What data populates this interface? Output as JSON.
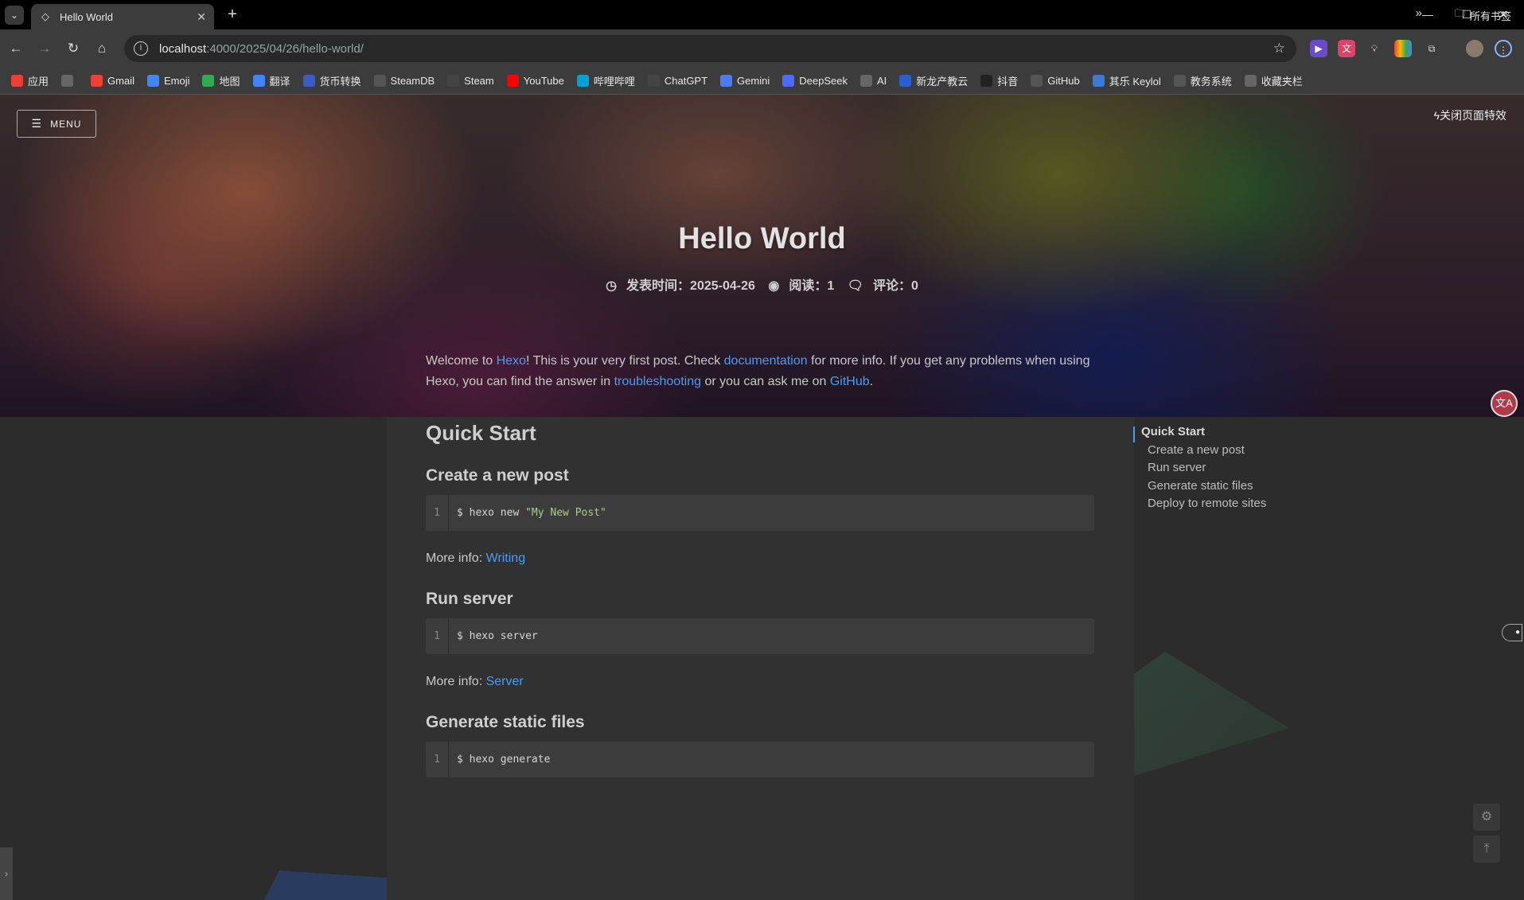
{
  "browser": {
    "tab_title": "Hello World",
    "url_host": "localhost",
    "url_path": ":4000/2025/04/26/hello-world/",
    "bookmarks": [
      {
        "label": "应用",
        "icon": "apps-grid-icon",
        "color": "#e94235"
      },
      {
        "label": "",
        "icon": "grid-icon",
        "color": "#666666"
      },
      {
        "label": "Gmail",
        "icon": "gmail-icon",
        "color": "#ea4335"
      },
      {
        "label": "Emoji",
        "icon": "google-icon",
        "color": "#4285f4"
      },
      {
        "label": "地图",
        "icon": "maps-icon",
        "color": "#34a853"
      },
      {
        "label": "翻译",
        "icon": "translate-icon",
        "color": "#4285f4"
      },
      {
        "label": "货币转换",
        "icon": "currency-icon",
        "color": "#3b5cc4"
      },
      {
        "label": "SteamDB",
        "icon": "steamdb-icon",
        "color": "#555555"
      },
      {
        "label": "Steam",
        "icon": "steam-icon",
        "color": "#444444"
      },
      {
        "label": "YouTube",
        "icon": "youtube-icon",
        "color": "#ff0000"
      },
      {
        "label": "哔哩哔哩",
        "icon": "bilibili-icon",
        "color": "#00a1d6"
      },
      {
        "label": "ChatGPT",
        "icon": "chatgpt-icon",
        "color": "#444444"
      },
      {
        "label": "Gemini",
        "icon": "gemini-icon",
        "color": "#4a7cf5"
      },
      {
        "label": "DeepSeek",
        "icon": "deepseek-icon",
        "color": "#4d6bfe"
      },
      {
        "label": "AI",
        "icon": "folder-icon",
        "color": "#666666"
      },
      {
        "label": "新龙产教云",
        "icon": "cloud-icon",
        "color": "#2a5fcf"
      },
      {
        "label": "抖音",
        "icon": "douyin-icon",
        "color": "#222222"
      },
      {
        "label": "GitHub",
        "icon": "github-icon",
        "color": "#555555"
      },
      {
        "label": "其乐 Keylol",
        "icon": "keylol-icon",
        "color": "#3a7bd5"
      },
      {
        "label": "教务系统",
        "icon": "globe-icon",
        "color": "#555555"
      },
      {
        "label": "收藏夹栏",
        "icon": "folder-icon",
        "color": "#666666"
      }
    ],
    "all_bookmarks": "所有书签"
  },
  "hero": {
    "menu_label": "MENU",
    "effects_toggle": "关闭页面特效",
    "title": "Hello World",
    "meta": {
      "published": "发表时间：2025-04-26",
      "reads": "阅读：1",
      "comments": "评论：0"
    }
  },
  "article": {
    "intro": {
      "p1": "Welcome to ",
      "hexo": "Hexo",
      "p2": "! This is your very first post. Check ",
      "documentation": "documentation",
      "p3": " for more info. If you get any problems when using Hexo, you can find the answer in ",
      "troubleshooting": "troubleshooting",
      "p4": " or you can ask me on ",
      "github": "GitHub",
      "p5": "."
    },
    "h1": "Quick Start",
    "sections": [
      {
        "heading": "Create a new post",
        "line": "1",
        "cmd": "$ hexo new ",
        "str": "\"My New Post\"",
        "more_label": "More info: ",
        "link": "Writing"
      },
      {
        "heading": "Run server",
        "line": "1",
        "cmd": "$ hexo server",
        "str": "",
        "more_label": "More info: ",
        "link": "Server"
      },
      {
        "heading": "Generate static files",
        "line": "1",
        "cmd": "$ hexo generate",
        "str": ""
      }
    ]
  },
  "toc": {
    "items": [
      "Quick Start",
      "Create a new post",
      "Run server",
      "Generate static files",
      "Deploy to remote sites"
    ]
  }
}
